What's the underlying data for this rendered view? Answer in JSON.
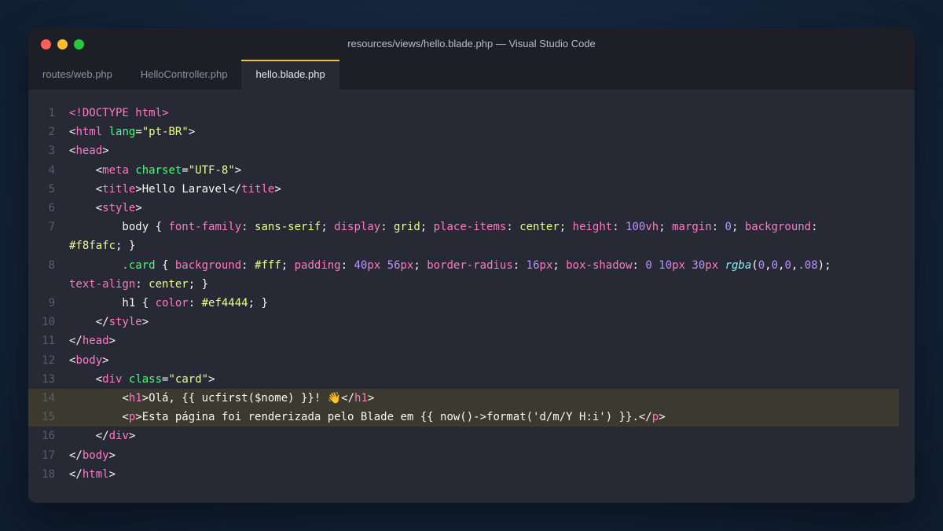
{
  "window": {
    "title": "resources/views/hello.blade.php — Visual Studio Code",
    "traffic_lights": [
      {
        "name": "close",
        "color": "#ff5f57"
      },
      {
        "name": "minimize",
        "color": "#febc2e"
      },
      {
        "name": "maximize",
        "color": "#28c840"
      }
    ]
  },
  "tabs": [
    {
      "label": "routes/web.php",
      "active": false
    },
    {
      "label": "HelloController.php",
      "active": false
    },
    {
      "label": "hello.blade.php",
      "active": true
    }
  ],
  "colors": {
    "accent": "#f1c232",
    "highlight": "#3c3a2e",
    "editor_bg": "#272935"
  },
  "lines": [
    {
      "num": "1",
      "highlight": false,
      "tokens": [
        [
          "tag",
          "<!DOCTYPE html>"
        ]
      ]
    },
    {
      "num": "2",
      "highlight": false,
      "tokens": [
        [
          "sel",
          "<"
        ],
        [
          "tag",
          "html"
        ],
        [
          "sel",
          " "
        ],
        [
          "attr",
          "lang"
        ],
        [
          "sel",
          "="
        ],
        [
          "str",
          "\"pt-BR\""
        ],
        [
          "sel",
          ">"
        ]
      ]
    },
    {
      "num": "3",
      "highlight": false,
      "tokens": [
        [
          "sel",
          "<"
        ],
        [
          "tag",
          "head"
        ],
        [
          "sel",
          ">"
        ]
      ]
    },
    {
      "num": "4",
      "highlight": false,
      "tokens": [
        [
          "sel",
          "    <"
        ],
        [
          "tag",
          "meta"
        ],
        [
          "sel",
          " "
        ],
        [
          "attr",
          "charset"
        ],
        [
          "sel",
          "="
        ],
        [
          "str",
          "\"UTF-8\""
        ],
        [
          "sel",
          ">"
        ]
      ]
    },
    {
      "num": "5",
      "highlight": false,
      "tokens": [
        [
          "sel",
          "    <"
        ],
        [
          "tag",
          "title"
        ],
        [
          "sel",
          ">Hello Laravel</"
        ],
        [
          "tag",
          "title"
        ],
        [
          "sel",
          ">"
        ]
      ]
    },
    {
      "num": "6",
      "highlight": false,
      "tokens": [
        [
          "sel",
          "    <"
        ],
        [
          "tag",
          "style"
        ],
        [
          "sel",
          ">"
        ]
      ]
    },
    {
      "num": "7",
      "highlight": false,
      "tokens": [
        [
          "sel",
          "        body { "
        ],
        [
          "prop",
          "font-family"
        ],
        [
          "sel",
          ": "
        ],
        [
          "val",
          "sans-serif"
        ],
        [
          "sel",
          "; "
        ],
        [
          "prop",
          "display"
        ],
        [
          "sel",
          ": "
        ],
        [
          "val",
          "grid"
        ],
        [
          "sel",
          "; "
        ],
        [
          "prop",
          "place-items"
        ],
        [
          "sel",
          ": "
        ],
        [
          "val",
          "center"
        ],
        [
          "sel",
          "; "
        ],
        [
          "prop",
          "height"
        ],
        [
          "sel",
          ": "
        ],
        [
          "num",
          "100"
        ],
        [
          "unit",
          "vh"
        ],
        [
          "sel",
          "; "
        ],
        [
          "prop",
          "margin"
        ],
        [
          "sel",
          ": "
        ],
        [
          "num",
          "0"
        ],
        [
          "sel",
          "; "
        ],
        [
          "prop",
          "background"
        ],
        [
          "sel",
          ":"
        ]
      ]
    },
    {
      "num": "",
      "highlight": false,
      "tokens": [
        [
          "hex",
          "#f8fafc"
        ],
        [
          "sel",
          "; }"
        ]
      ]
    },
    {
      "num": "8",
      "highlight": false,
      "tokens": [
        [
          "cls",
          "        .card"
        ],
        [
          "sel",
          " { "
        ],
        [
          "prop",
          "background"
        ],
        [
          "sel",
          ": "
        ],
        [
          "hex",
          "#fff"
        ],
        [
          "sel",
          "; "
        ],
        [
          "prop",
          "padding"
        ],
        [
          "sel",
          ": "
        ],
        [
          "num",
          "40"
        ],
        [
          "unit",
          "px"
        ],
        [
          "sel",
          " "
        ],
        [
          "num",
          "56"
        ],
        [
          "unit",
          "px"
        ],
        [
          "sel",
          "; "
        ],
        [
          "prop",
          "border-radius"
        ],
        [
          "sel",
          ": "
        ],
        [
          "num",
          "16"
        ],
        [
          "unit",
          "px"
        ],
        [
          "sel",
          "; "
        ],
        [
          "prop",
          "box-shadow"
        ],
        [
          "sel",
          ": "
        ],
        [
          "num",
          "0"
        ],
        [
          "sel",
          " "
        ],
        [
          "num",
          "10"
        ],
        [
          "unit",
          "px"
        ],
        [
          "sel",
          " "
        ],
        [
          "num",
          "30"
        ],
        [
          "unit",
          "px"
        ],
        [
          "sel",
          " "
        ],
        [
          "fn",
          "rgba"
        ],
        [
          "sel",
          "("
        ],
        [
          "num",
          "0"
        ],
        [
          "sel",
          ","
        ],
        [
          "num",
          "0"
        ],
        [
          "sel",
          ","
        ],
        [
          "num",
          "0"
        ],
        [
          "sel",
          ","
        ],
        [
          "num",
          ".08"
        ],
        [
          "sel",
          ");"
        ]
      ]
    },
    {
      "num": "",
      "highlight": false,
      "tokens": [
        [
          "prop",
          "text-align"
        ],
        [
          "sel",
          ": "
        ],
        [
          "val",
          "center"
        ],
        [
          "sel",
          "; }"
        ]
      ]
    },
    {
      "num": "9",
      "highlight": false,
      "tokens": [
        [
          "sel",
          "        h1 { "
        ],
        [
          "prop",
          "color"
        ],
        [
          "sel",
          ": "
        ],
        [
          "hex",
          "#ef4444"
        ],
        [
          "sel",
          "; }"
        ]
      ]
    },
    {
      "num": "10",
      "highlight": false,
      "tokens": [
        [
          "sel",
          "    </"
        ],
        [
          "tag",
          "style"
        ],
        [
          "sel",
          ">"
        ]
      ]
    },
    {
      "num": "11",
      "highlight": false,
      "tokens": [
        [
          "sel",
          "</"
        ],
        [
          "tag",
          "head"
        ],
        [
          "sel",
          ">"
        ]
      ]
    },
    {
      "num": "12",
      "highlight": false,
      "tokens": [
        [
          "sel",
          "<"
        ],
        [
          "tag",
          "body"
        ],
        [
          "sel",
          ">"
        ]
      ]
    },
    {
      "num": "13",
      "highlight": false,
      "tokens": [
        [
          "sel",
          "    <"
        ],
        [
          "tag",
          "div"
        ],
        [
          "sel",
          " "
        ],
        [
          "attr",
          "class"
        ],
        [
          "sel",
          "="
        ],
        [
          "str",
          "\"card\""
        ],
        [
          "sel",
          ">"
        ]
      ]
    },
    {
      "num": "14",
      "highlight": true,
      "tokens": [
        [
          "sel",
          "        <"
        ],
        [
          "tag",
          "h1"
        ],
        [
          "sel",
          ">Olá, {{ ucfirst($nome) }}! 👋</"
        ],
        [
          "tag",
          "h1"
        ],
        [
          "sel",
          ">"
        ]
      ]
    },
    {
      "num": "15",
      "highlight": true,
      "tokens": [
        [
          "sel",
          "        <"
        ],
        [
          "tag",
          "p"
        ],
        [
          "sel",
          ">Esta página foi renderizada pelo Blade em {{ now()->format('d/m/Y H:i') }}.</"
        ],
        [
          "tag",
          "p"
        ],
        [
          "sel",
          ">"
        ]
      ]
    },
    {
      "num": "16",
      "highlight": false,
      "tokens": [
        [
          "sel",
          "    </"
        ],
        [
          "tag",
          "div"
        ],
        [
          "sel",
          ">"
        ]
      ]
    },
    {
      "num": "17",
      "highlight": false,
      "tokens": [
        [
          "sel",
          "</"
        ],
        [
          "tag",
          "body"
        ],
        [
          "sel",
          ">"
        ]
      ]
    },
    {
      "num": "18",
      "highlight": false,
      "tokens": [
        [
          "sel",
          "</"
        ],
        [
          "tag",
          "html"
        ],
        [
          "sel",
          ">"
        ]
      ]
    }
  ]
}
